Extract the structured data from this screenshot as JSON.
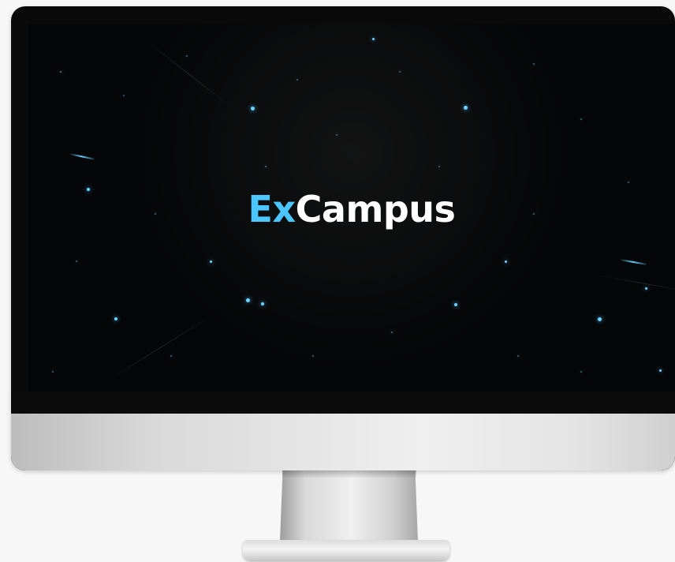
{
  "logo": {
    "prefix": "Ex",
    "suffix": "Campus",
    "accent_color": "#4cc6ff",
    "text_color": "#ffffff"
  },
  "screen": {
    "background_color": "#050607",
    "star_color": "#6fd3ff"
  },
  "device": {
    "type": "desktop-monitor",
    "frame_color": "#0a0a0a",
    "chin_color": "#e6e6e6"
  }
}
